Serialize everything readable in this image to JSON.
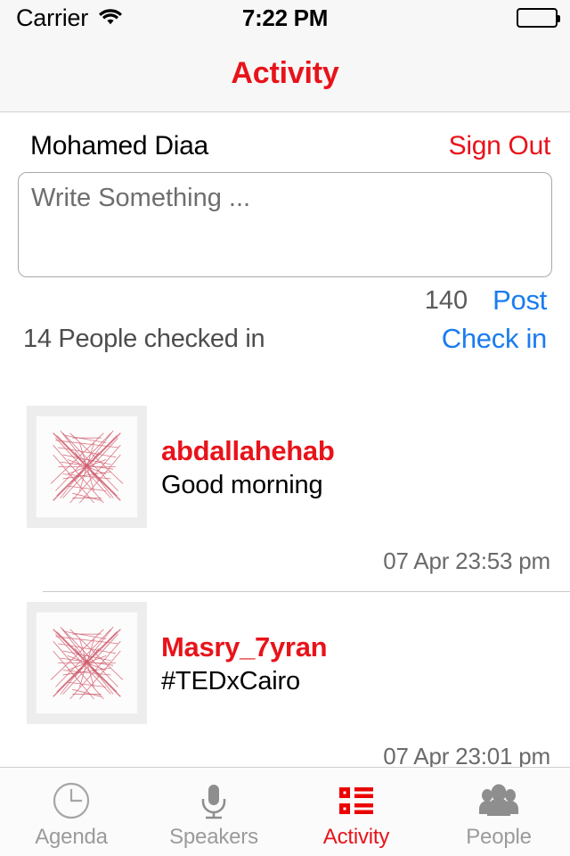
{
  "status_bar": {
    "carrier": "Carrier",
    "wifi_icon": "wifi-icon",
    "time": "7:22 PM",
    "battery_icon": "battery-full-icon"
  },
  "nav": {
    "title": "Activity"
  },
  "compose": {
    "user_name": "Mohamed Diaa",
    "sign_out_label": "Sign Out",
    "textarea_placeholder": "Write Something ...",
    "textarea_value": "",
    "char_counter": "140",
    "post_label": "Post",
    "checkin_count": "14 People checked in",
    "check_in_label": "Check in"
  },
  "feed": {
    "posts": [
      {
        "avatar_icon": "tedx-x-avatar-icon",
        "user": "abdallahehab",
        "text": "Good morning",
        "time": "07 Apr 23:53 pm"
      },
      {
        "avatar_icon": "tedx-x-avatar-icon",
        "user": "Masry_7yran",
        "text": "#TEDxCairo",
        "time": "07 Apr 23:01 pm"
      }
    ]
  },
  "tab_bar": {
    "items": [
      {
        "label": "Agenda",
        "icon": "clock-icon",
        "active": false
      },
      {
        "label": "Speakers",
        "icon": "microphone-icon",
        "active": false
      },
      {
        "label": "Activity",
        "icon": "list-icon",
        "active": true
      },
      {
        "label": "People",
        "icon": "people-icon",
        "active": false
      }
    ]
  },
  "colors": {
    "accent_red": "#e8131a",
    "link_blue": "#1a7cf0",
    "muted_gray": "#9b9b9b",
    "chrome_gray": "#f7f7f7"
  }
}
